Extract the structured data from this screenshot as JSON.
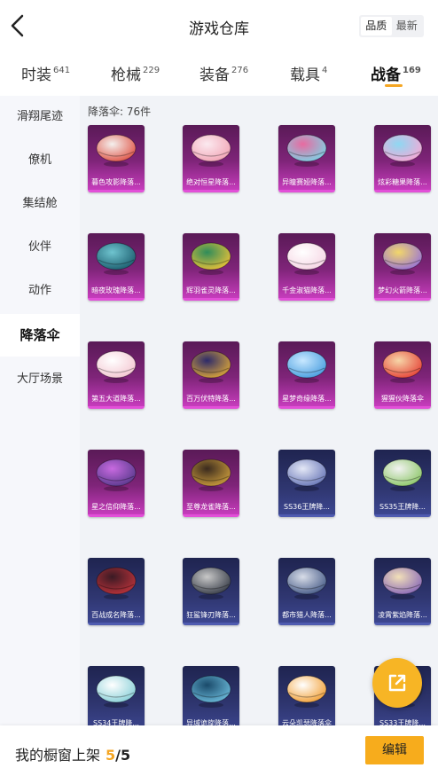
{
  "header": {
    "title": "游戏仓库",
    "sort_options": [
      "品质",
      "最新"
    ]
  },
  "tabs": [
    {
      "label": "时装",
      "count": "641"
    },
    {
      "label": "枪械",
      "count": "229"
    },
    {
      "label": "装备",
      "count": "276"
    },
    {
      "label": "载具",
      "count": "4"
    },
    {
      "label": "战备",
      "count": "169"
    }
  ],
  "sidebar": [
    "滑翔尾迹",
    "僚机",
    "集结舱",
    "伙伴",
    "动作",
    "降落伞",
    "大厅场景"
  ],
  "content": {
    "count_label": "降落伞: 76件"
  },
  "items": [
    {
      "name": "暮色攻影降落...",
      "rarity": "purple",
      "c1": "#e0584a",
      "c2": "#f4f0ee"
    },
    {
      "name": "绝对恒星降落...",
      "rarity": "purple",
      "c1": "#f2a6b6",
      "c2": "#fbeaf0"
    },
    {
      "name": "异瞳赛娅降落...",
      "rarity": "purple",
      "c1": "#7fd0e4",
      "c2": "#e86aa0"
    },
    {
      "name": "炫彩糖果降落...",
      "rarity": "purple",
      "c1": "#f6a9d6",
      "c2": "#8ed8f2"
    },
    {
      "name": "暗夜玫瑰降落...",
      "rarity": "purple",
      "c1": "#1d5f70",
      "c2": "#6fc4cf"
    },
    {
      "name": "辉羽雀灵降落...",
      "rarity": "purple",
      "c1": "#e6c03a",
      "c2": "#2f8c5a"
    },
    {
      "name": "千金淑猫降落...",
      "rarity": "purple",
      "c1": "#f6d6e4",
      "c2": "#ffffff"
    },
    {
      "name": "梦幻火箭降落...",
      "rarity": "purple",
      "c1": "#9a74d6",
      "c2": "#f2d76a"
    },
    {
      "name": "第五大道降落...",
      "rarity": "purple",
      "c1": "#f4c8d2",
      "c2": "#ffffff"
    },
    {
      "name": "百万伏特降落...",
      "rarity": "purple",
      "c1": "#d8a43a",
      "c2": "#2d2a6a"
    },
    {
      "name": "星梦奇缘降落...",
      "rarity": "purple",
      "c1": "#4b9fe0",
      "c2": "#c8e8ff"
    },
    {
      "name": "猩猩伙降落伞",
      "rarity": "purple",
      "c1": "#e6463a",
      "c2": "#f6d6a8"
    },
    {
      "name": "星之信仰降落...",
      "rarity": "purple",
      "c1": "#5a3a8e",
      "c2": "#c86ae0"
    },
    {
      "name": "至尊龙雀降落...",
      "rarity": "purple",
      "c1": "#c89a3c",
      "c2": "#3a2a1e"
    },
    {
      "name": "SS36王牌降...",
      "rarity": "blue",
      "c1": "#6a78b8",
      "c2": "#e4e8f6"
    },
    {
      "name": "SS35王牌降...",
      "rarity": "blue",
      "c1": "#8ec86a",
      "c2": "#f2f2f2"
    },
    {
      "name": "百战成名降落...",
      "rarity": "blue",
      "c1": "#b8323a",
      "c2": "#3a1a24"
    },
    {
      "name": "狂鲨锋刃降落...",
      "rarity": "blue",
      "c1": "#3a3f4a",
      "c2": "#c8c8c8"
    },
    {
      "name": "都市猎人降落...",
      "rarity": "blue",
      "c1": "#4a5e8a",
      "c2": "#d8dde8"
    },
    {
      "name": "凌霄紫焰降落...",
      "rarity": "blue",
      "c1": "#8a6ab8",
      "c2": "#f2e0b8"
    },
    {
      "name": "SS34王牌降...",
      "rarity": "blue",
      "c1": "#8ad0d8",
      "c2": "#ffffff"
    },
    {
      "name": "异域诡旋降落...",
      "rarity": "blue",
      "c1": "#6ab8d8",
      "c2": "#1a4a6a"
    },
    {
      "name": "云朵凯瑟降落伞",
      "rarity": "blue",
      "c1": "#f2a23a",
      "c2": "#ffffff"
    },
    {
      "name": "SS33王牌降...",
      "rarity": "blue",
      "c1": "#2a2a36",
      "c2": "#e8e8e8"
    }
  ],
  "footer": {
    "label": "我的橱窗上架",
    "current": "5",
    "total": "/5",
    "edit_label": "编辑"
  },
  "colors": {
    "accent": "#f5a623",
    "epic_border": "#e24fd8",
    "rare_border": "#4f5bb0"
  }
}
